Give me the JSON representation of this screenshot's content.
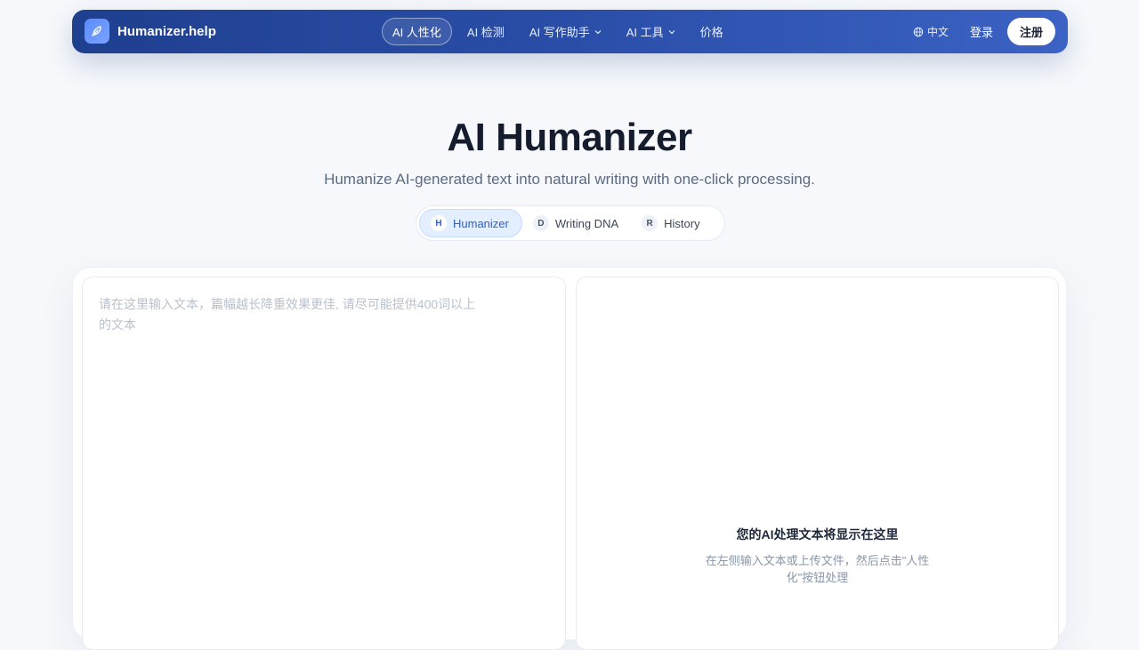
{
  "brand": {
    "name": "Humanizer.help",
    "logo_icon": "feather-pen-icon",
    "accent": "#5b8cff"
  },
  "nav": {
    "links": [
      {
        "label": "AI 人性化",
        "active": true,
        "dropdown": false
      },
      {
        "label": "AI 检测",
        "active": false,
        "dropdown": false
      },
      {
        "label": "AI 写作助手",
        "active": false,
        "dropdown": true
      },
      {
        "label": "AI 工具",
        "active": false,
        "dropdown": true
      },
      {
        "label": "价格",
        "active": false,
        "dropdown": false
      }
    ],
    "language": "中文",
    "login_label": "登录",
    "signup_label": "注册",
    "colors": {
      "gradient_start": "#1f3f8f",
      "gradient_end": "#3b62c4"
    }
  },
  "hero": {
    "title": "AI Humanizer",
    "subtitle": "Humanize AI-generated text into natural writing with one-click processing."
  },
  "modes": [
    {
      "badge": "H",
      "label": "Humanizer",
      "active": true
    },
    {
      "badge": "D",
      "label": "Writing DNA",
      "active": false
    },
    {
      "badge": "R",
      "label": "History",
      "active": false
    }
  ],
  "editor": {
    "input_value": "",
    "input_placeholder": "请在这里输入文本，篇幅越长降重效果更佳, 请尽可能提供400词以上的文本",
    "output_title": "您的AI处理文本将显示在这里",
    "output_hint": "在左侧输入文本或上传文件，然后点击\"人性化\"按钮处理"
  }
}
